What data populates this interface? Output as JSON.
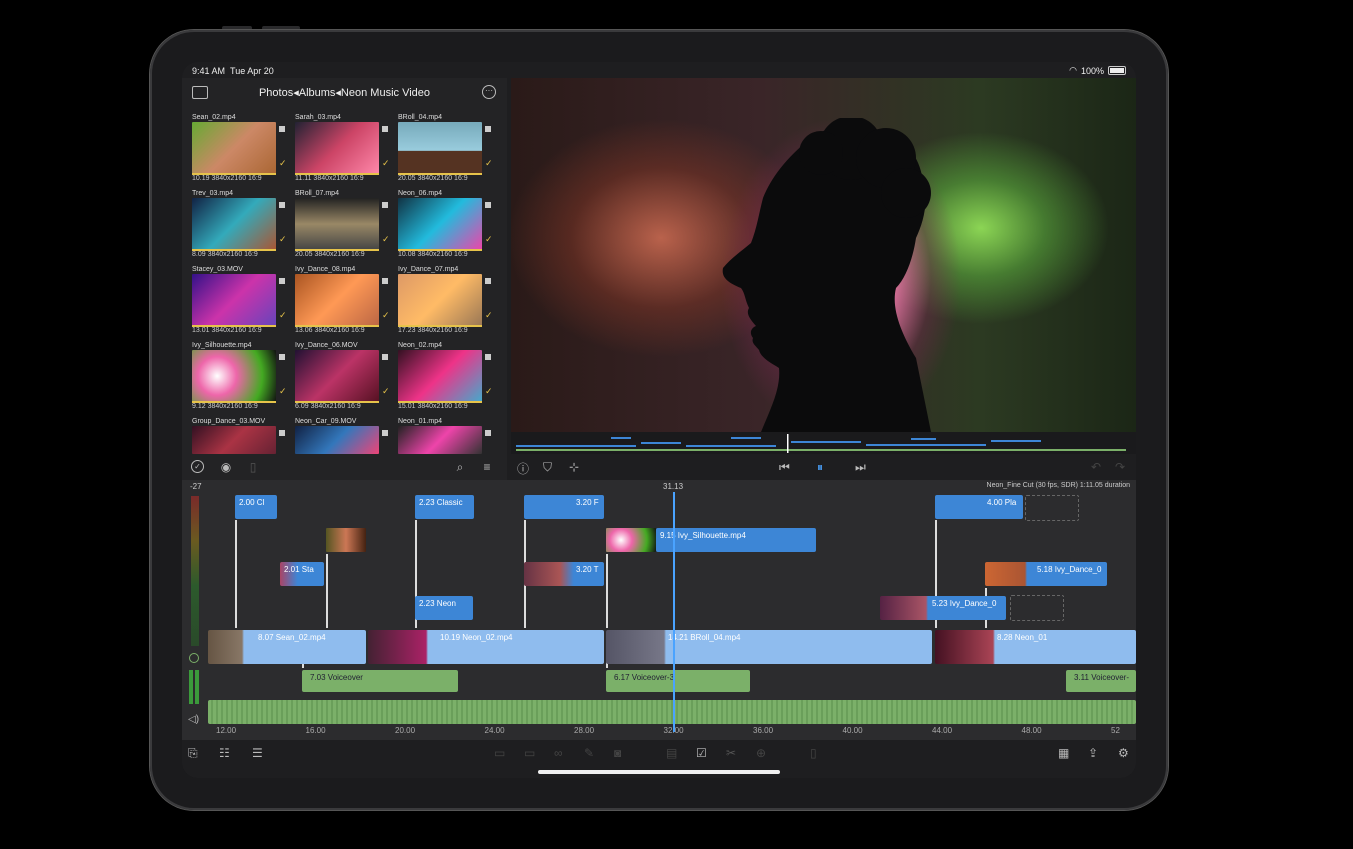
{
  "status_bar": {
    "time": "9:41 AM",
    "date": "Tue Apr 20",
    "battery": "100%"
  },
  "browser": {
    "title": "Photos◂Albums◂Neon Music Video",
    "clips": [
      {
        "name": "Sean_02.mp4",
        "meta": "10.19  3840x2160  16:9",
        "checked": true
      },
      {
        "name": "Sarah_03.mp4",
        "meta": "11.11  3840x2160  16:9",
        "checked": true
      },
      {
        "name": "BRoll_04.mp4",
        "meta": "20.05  3840x2160  16:9",
        "checked": true
      },
      {
        "name": "Trev_03.mp4",
        "meta": "8.09  3840x2160  16:9",
        "checked": true
      },
      {
        "name": "BRoll_07.mp4",
        "meta": "20.05  3840x2160  16:9",
        "checked": true
      },
      {
        "name": "Neon_06.mp4",
        "meta": "10.08  3840x2160  16:9",
        "checked": true
      },
      {
        "name": "Stacey_03.MOV",
        "meta": "13.01  3840x2160  16:9",
        "checked": true
      },
      {
        "name": "Ivy_Dance_08.mp4",
        "meta": "13.06  3840x2160  16:9",
        "checked": true
      },
      {
        "name": "Ivy_Dance_07.mp4",
        "meta": "17.23  3840x2160  16:9",
        "checked": true
      },
      {
        "name": "Ivy_Silhouette.mp4",
        "meta": "9.12  3840x2160  16:9",
        "checked": true
      },
      {
        "name": "Ivy_Dance_06.MOV",
        "meta": "6.09  3840x2160  16:9",
        "checked": true
      },
      {
        "name": "Neon_02.mp4",
        "meta": "15.01  3840x2160  16:9",
        "checked": true
      },
      {
        "name": "Group_Dance_03.MOV",
        "meta": "",
        "checked": false
      },
      {
        "name": "Neon_Car_09.MOV",
        "meta": "",
        "checked": false
      },
      {
        "name": "Neon_01.mp4",
        "meta": "",
        "checked": false
      }
    ]
  },
  "timeline": {
    "playhead_time": "31.13",
    "project_info": "Neon_Fine Cut (30 fps, SDR)  1:11.05 duration",
    "level_label": "-27",
    "ruler": [
      "12.00",
      "16.00",
      "20.00",
      "24.00",
      "28.00",
      "32.00",
      "36.00",
      "40.00",
      "44.00",
      "48.00",
      "52"
    ],
    "title_clips": [
      {
        "label": "2.00  Cl"
      },
      {
        "label": "2.23  Classic"
      },
      {
        "label": "3.20  F"
      },
      {
        "label": "4.00  Pla"
      }
    ],
    "connected_clips": [
      {
        "label": "9.15  Ivy_Silhouette.mp4"
      },
      {
        "label": "2.01  Sta"
      },
      {
        "label": "3.20  T"
      },
      {
        "label": "2.23  Neon"
      },
      {
        "label": "5.18  Ivy_Dance_0"
      },
      {
        "label": "5.23  Ivy_Dance_0"
      }
    ],
    "primary_clips": [
      {
        "label": "8.07  Sean_02.mp4"
      },
      {
        "label": "10.19  Neon_02.mp4"
      },
      {
        "label": "14.21  BRoll_04.mp4"
      },
      {
        "label": "8.28  Neon_01"
      }
    ],
    "voiceovers": [
      {
        "label": "7.03  Voiceover"
      },
      {
        "label": "6.17  Voiceover-3"
      },
      {
        "label": "3.11  Voiceover-"
      }
    ]
  },
  "colors": {
    "clip_blue": "#3d86d6",
    "audio_green": "#7bb069",
    "playhead": "#4aa3ff",
    "check": "#e6c34a"
  }
}
